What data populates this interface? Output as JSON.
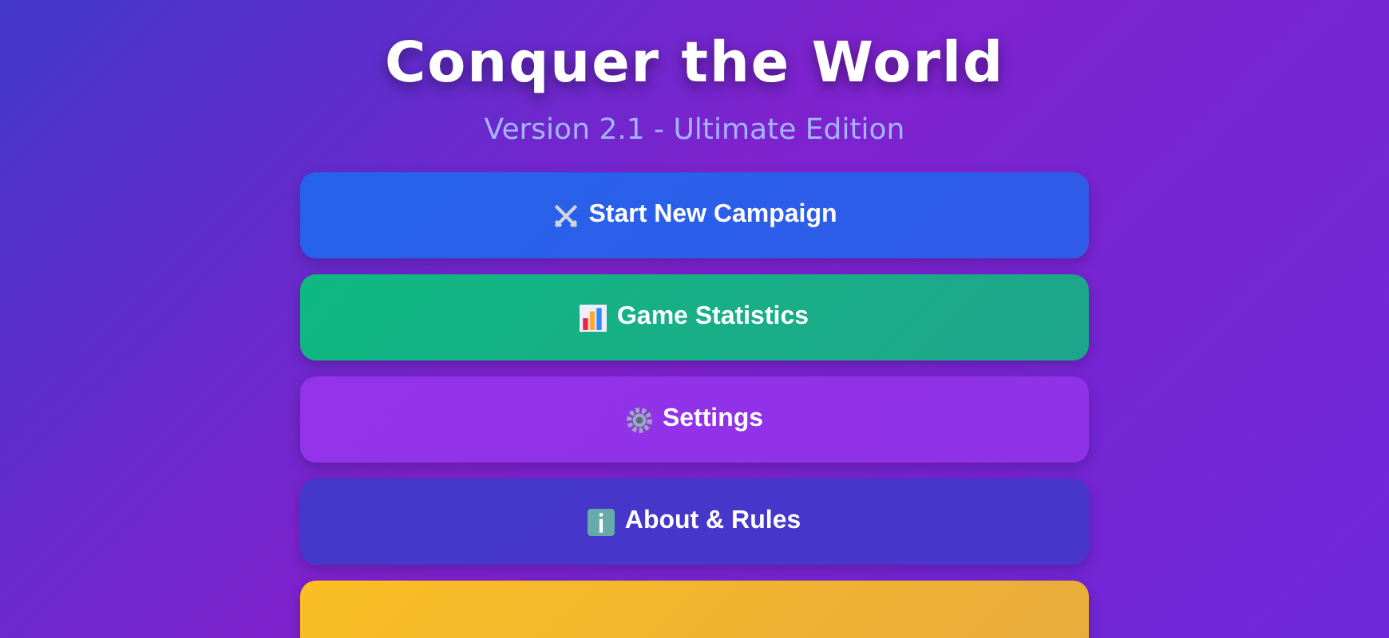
{
  "title": "Conquer the World",
  "subtitle": "Version 2.1 - Ultimate Edition",
  "menu": [
    {
      "kind": "swords",
      "label": "Start New Campaign",
      "color": "#2563eb"
    },
    {
      "kind": "chart",
      "label": "Game Statistics",
      "color": "#10b981"
    },
    {
      "kind": "gear",
      "label": "Settings",
      "color": "#9333ea"
    },
    {
      "kind": "info",
      "label": "About & Rules",
      "color": "#4338ca"
    },
    {
      "kind": "blank",
      "color": "#fbbf24"
    }
  ]
}
